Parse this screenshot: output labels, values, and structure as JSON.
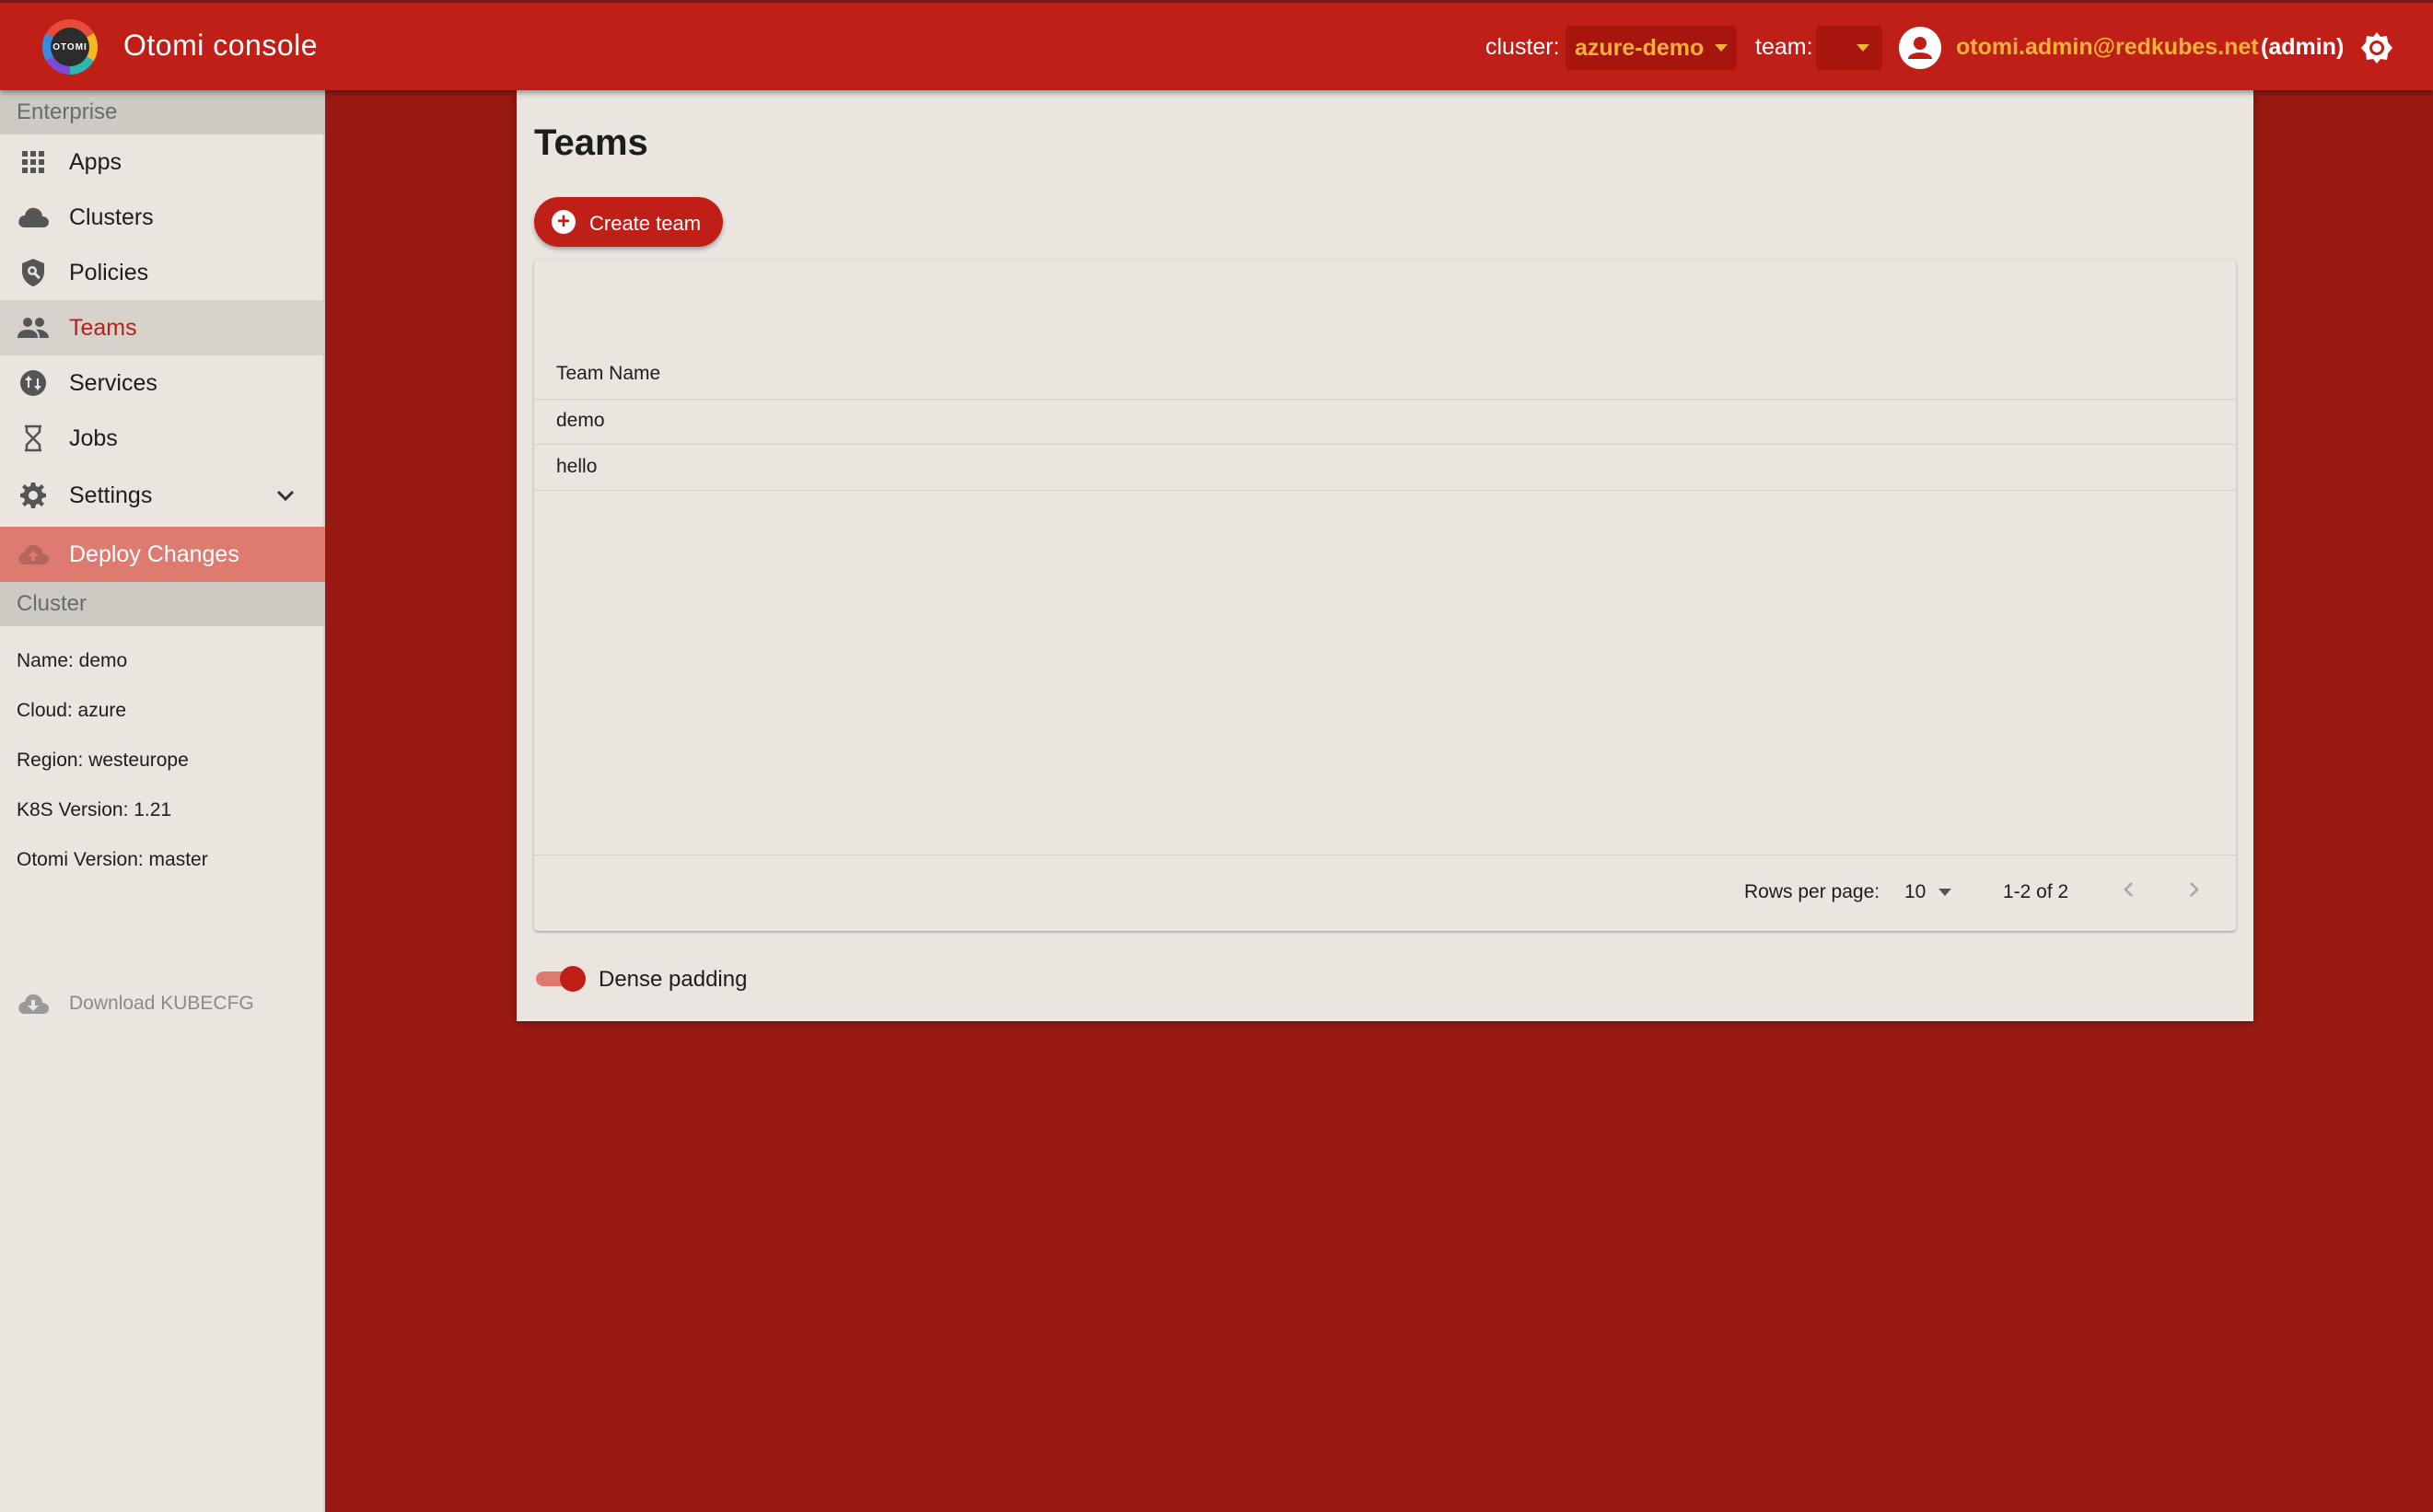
{
  "header": {
    "logo_text": "OTOMI",
    "app_title": "Otomi console",
    "cluster_label": "cluster:",
    "cluster_value": "azure-demo",
    "team_label": "team:",
    "team_value": "",
    "user_email": "otomi.admin@redkubes.net",
    "user_role": "(admin)"
  },
  "sidebar": {
    "enterprise_header": "Enterprise",
    "items": [
      {
        "label": "Apps",
        "icon": "apps-grid-icon"
      },
      {
        "label": "Clusters",
        "icon": "cloud-icon"
      },
      {
        "label": "Policies",
        "icon": "shield-search-icon"
      },
      {
        "label": "Teams",
        "icon": "people-icon"
      },
      {
        "label": "Services",
        "icon": "swap-vertical-icon"
      },
      {
        "label": "Jobs",
        "icon": "hourglass-icon"
      },
      {
        "label": "Settings",
        "icon": "gear-icon"
      },
      {
        "label": "Deploy Changes",
        "icon": "cloud-upload-icon"
      }
    ],
    "cluster_header": "Cluster",
    "cluster_info": {
      "name": "Name: demo",
      "cloud": "Cloud: azure",
      "region": "Region: westeurope",
      "k8s": "K8S Version: 1.21",
      "otomi": "Otomi Version: master"
    },
    "download_label": "Download KUBECFG"
  },
  "main": {
    "title": "Teams",
    "create_button": "Create team",
    "table": {
      "column_header": "Team Name",
      "rows": [
        "demo",
        "hello"
      ]
    },
    "pagination": {
      "rows_per_page_label": "Rows per page:",
      "rows_per_page_value": "10",
      "range": "1-2 of 2"
    },
    "dense_padding_label": "Dense padding",
    "dense_padding_on": true
  },
  "colors": {
    "topbar": "#c01f17",
    "accent": "#f5b13b",
    "background": "#971912",
    "active_nav": "#b8211a",
    "deploy": "#dd7b71"
  }
}
